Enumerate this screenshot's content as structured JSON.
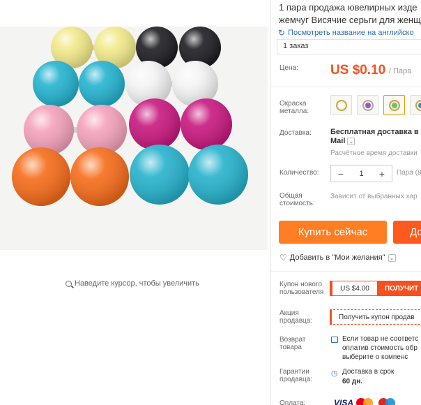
{
  "product": {
    "title_line1": "1 пара продажа ювелирных изде",
    "title_line2": "жемчуг Висячие серьги для женщ",
    "translate_link": "Посмотреть название на английско",
    "orders": "1 заказ"
  },
  "gallery": {
    "zoom_hint": "Наведите курсор, чтобы увеличить",
    "bead_colors": [
      "#f2e98a",
      "#1d1d22",
      "#24b3cf",
      "#f4f4f4",
      "#f4a2bc",
      "#c8187e",
      "#f66c1a",
      "#26b2cc"
    ]
  },
  "price": {
    "label": "Цена:",
    "value": "US $0.10",
    "unit": "/ Пара",
    "color": "#f5501e"
  },
  "color_option": {
    "label": "Окраска металла:",
    "swatch_icons": [
      "earring-gold-white-icon",
      "earring-silver-purple-icon",
      "earring-gold-green-icon",
      "earring-gold-blue-icon"
    ],
    "selected_index": 2
  },
  "shipping": {
    "label": "Доставка:",
    "main": "Бесплатная доставка в R",
    "method": "Mail",
    "estimate": "Расчётное время доставки"
  },
  "quantity": {
    "label": "Количество:",
    "value": "1",
    "minus": "−",
    "plus": "+",
    "unit": "Пара (8"
  },
  "total": {
    "label": "Общая стоимость:",
    "value": "Зависит от выбранных хар"
  },
  "actions": {
    "buy_now": "Купить сейчас",
    "add_to_cart": "До",
    "wishlist": "Добавить в \"Мои желания\""
  },
  "coupon": {
    "label": "Купон нового пользователя",
    "amount": "US $4.00",
    "get": "ПОЛУЧИТ"
  },
  "seller_promo": {
    "label": "Акция продавца:",
    "button": "Получить купон продав"
  },
  "returns": {
    "label": "Возврат товара",
    "line1": "Если товар не соответс",
    "line2": "оплатив стоимость обр",
    "line3": "выберите о компенс"
  },
  "guarantee": {
    "label": "Гарантии продавца:",
    "line1": "Доставка в срок",
    "line2": "60 дн."
  },
  "payment": {
    "label": "Оплата:",
    "visa": "VISA"
  }
}
